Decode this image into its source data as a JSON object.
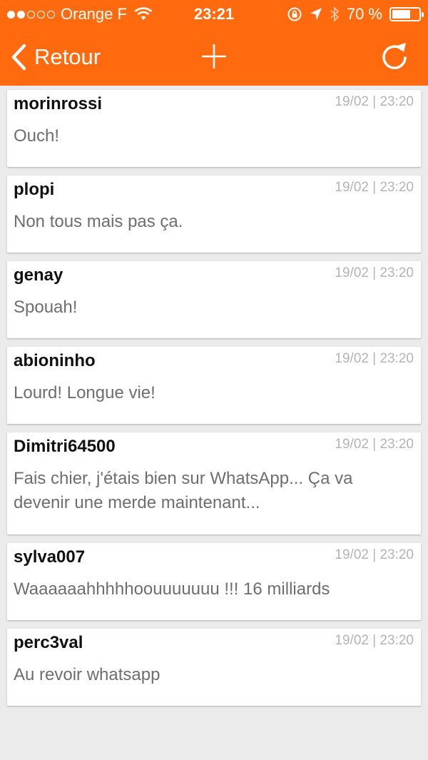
{
  "theme": {
    "accent": "#ff6a0e",
    "background": "#ebebeb"
  },
  "status_bar": {
    "carrier": "Orange F",
    "time": "23:21",
    "battery": "70 %",
    "battery_level": 0.7
  },
  "nav": {
    "back_label": "Retour"
  },
  "comments": [
    {
      "author": "morinrossi",
      "date": "19/02",
      "time": "23:20",
      "text": "Ouch!"
    },
    {
      "author": "plopi",
      "date": "19/02",
      "time": "23:20",
      "text": "Non tous mais pas ça."
    },
    {
      "author": "genay",
      "date": "19/02",
      "time": "23:20",
      "text": "Spouah!"
    },
    {
      "author": "abioninho",
      "date": "19/02",
      "time": "23:20",
      "text": "Lourd! Longue vie!"
    },
    {
      "author": "Dimitri64500",
      "date": "19/02",
      "time": "23:20",
      "text": "Fais chier, j'étais bien sur WhatsApp... Ça va devenir une merde maintenant..."
    },
    {
      "author": "sylva007",
      "date": "19/02",
      "time": "23:20",
      "text": "Waaaaaahhhhhoouuuuuuu !!! 16 milliards"
    },
    {
      "author": "perc3val",
      "date": "19/02",
      "time": "23:20",
      "text": "Au revoir whatsapp"
    }
  ]
}
